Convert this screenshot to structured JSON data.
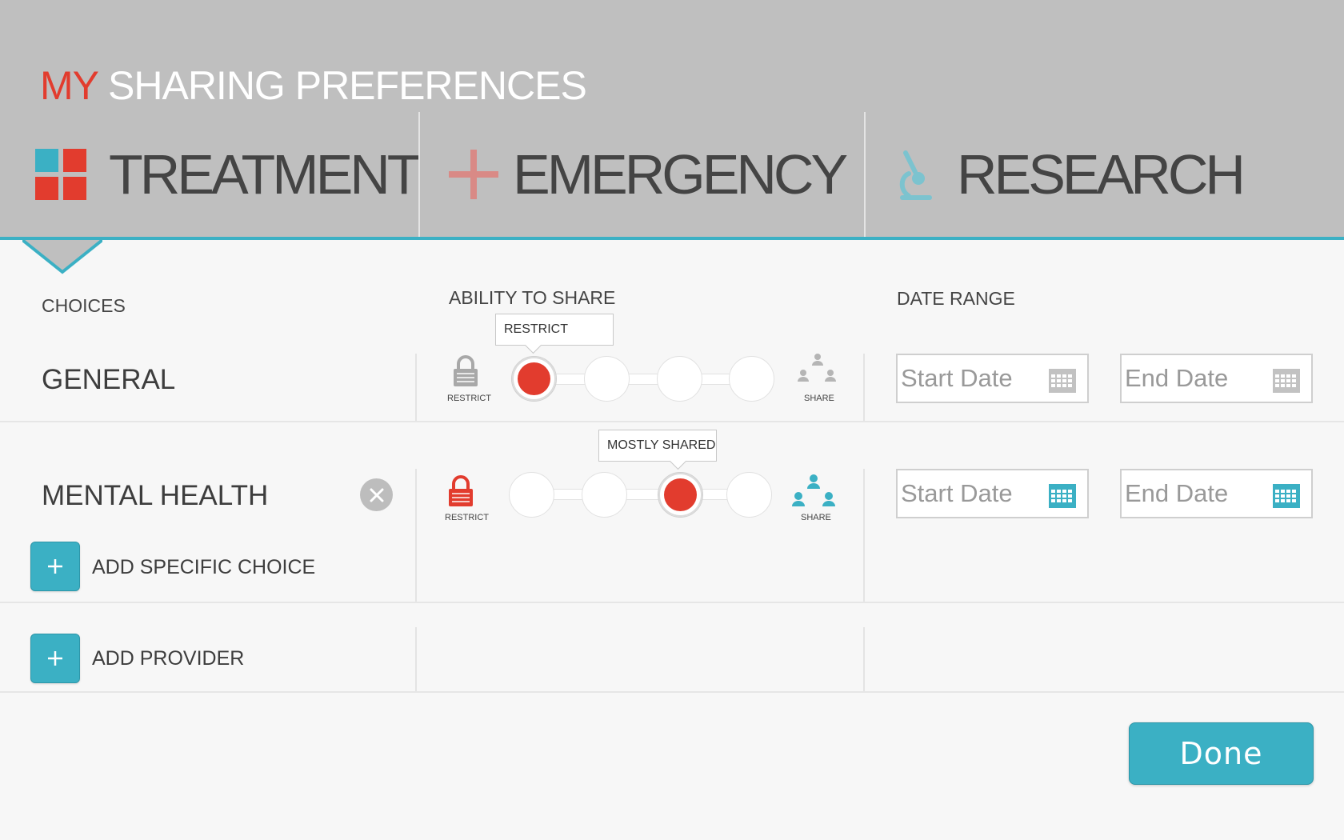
{
  "header": {
    "title_my": "MY",
    "title_rest": "SHARING PREFERENCES",
    "tabs": [
      {
        "label": "TREATMENT",
        "icon": "grid-icon",
        "active": true
      },
      {
        "label": "EMERGENCY",
        "icon": "plus-cross-icon",
        "active": false
      },
      {
        "label": "RESEARCH",
        "icon": "microscope-icon",
        "active": false
      }
    ]
  },
  "columns": {
    "choices": "CHOICES",
    "ability": "ABILITY TO SHARE",
    "date_range": "DATE RANGE"
  },
  "rows": [
    {
      "label": "GENERAL",
      "share_level_index": 0,
      "share_level_label": "RESTRICT",
      "restrict_caption": "RESTRICT",
      "share_caption": "SHARE",
      "start_placeholder": "Start Date",
      "end_placeholder": "End Date",
      "active_colors": false
    },
    {
      "label": "MENTAL HEALTH",
      "share_level_index": 2,
      "share_level_label": "MOSTLY SHARED",
      "restrict_caption": "RESTRICT",
      "share_caption": "SHARE",
      "start_placeholder": "Start Date",
      "end_placeholder": "End Date",
      "active_colors": true,
      "add_choice_label": "ADD SPECIFIC CHOICE"
    }
  ],
  "add_provider_label": "ADD PROVIDER",
  "done_label": "Done",
  "colors": {
    "accent": "#3bb0c4",
    "red": "#e23c2e",
    "header_bg": "#bfbfbf"
  }
}
